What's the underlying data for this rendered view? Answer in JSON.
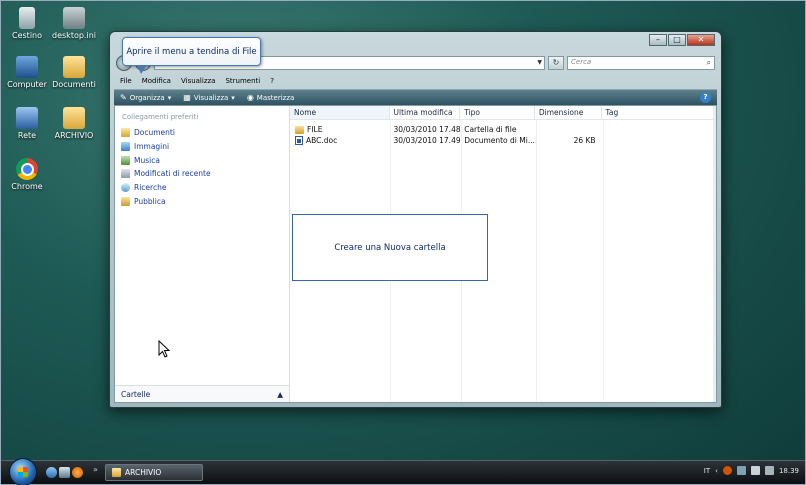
{
  "desktop": {
    "icons": [
      {
        "label": "Cestino"
      },
      {
        "label": "desktop.ini"
      },
      {
        "label": "Computer"
      },
      {
        "label": "Documenti"
      },
      {
        "label": "Rete"
      },
      {
        "label": "ARCHIVIO"
      },
      {
        "label": "Chrome"
      }
    ]
  },
  "window": {
    "controls": {
      "minimize": "–",
      "maximize": "□",
      "close": "✕"
    },
    "search_placeholder": "Cerca",
    "menu": [
      "File",
      "Modifica",
      "Visualizza",
      "Strumenti",
      "?"
    ],
    "toolbar": {
      "organize": "Organizza",
      "view": "Visualizza",
      "burn": "Masterizza",
      "help": "?"
    },
    "nav": {
      "title": "Collegamenti preferiti",
      "items": [
        "Documenti",
        "Immagini",
        "Musica",
        "Modificati di recente",
        "Ricerche",
        "Pubblica"
      ],
      "folders_label": "Cartelle"
    },
    "columns": [
      "Nome",
      "Ultima modifica",
      "Tipo",
      "Dimensione",
      "Tag"
    ],
    "files": [
      {
        "name": "FILE",
        "modified": "30/03/2010 17.48",
        "type": "Cartella di file",
        "size": "",
        "tag": ""
      },
      {
        "name": "ABC.doc",
        "modified": "30/03/2010 17.49",
        "type": "Documento di Mi...",
        "size": "26 KB",
        "tag": ""
      }
    ]
  },
  "callouts": {
    "top": "Aprire il menu a tendina di File",
    "box": "Creare una Nuova cartella"
  },
  "taskbar": {
    "task_label": "ARCHIVIO",
    "language": "IT",
    "clock": "18.39"
  }
}
